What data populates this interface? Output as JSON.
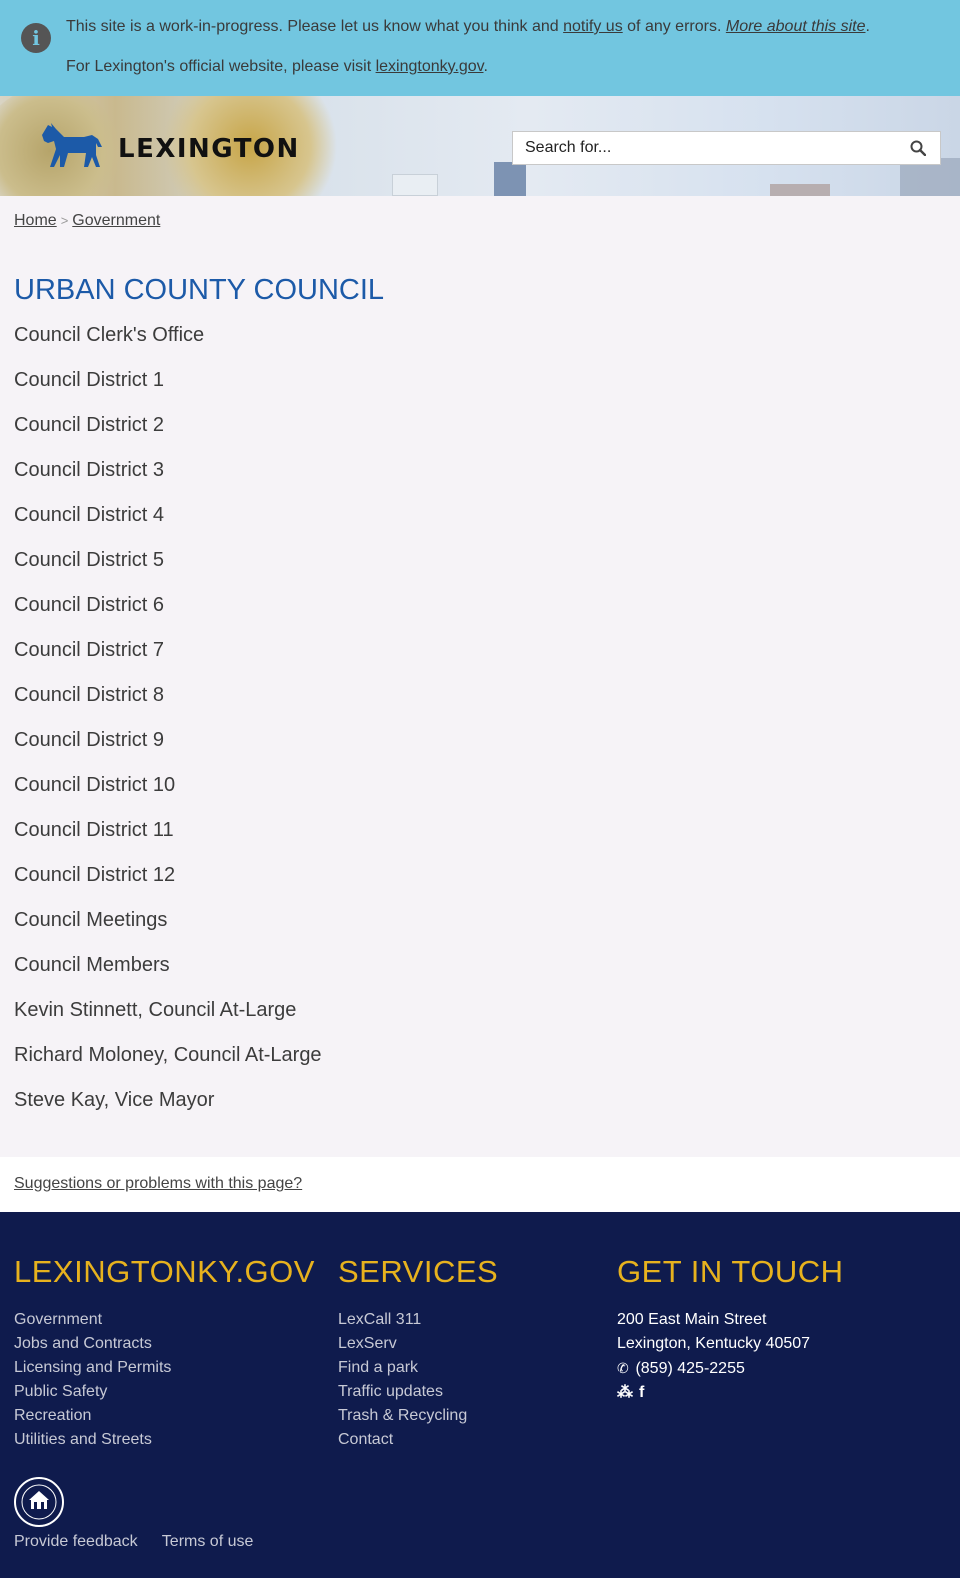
{
  "notice": {
    "line1_pre": "This site is a work-in-progress. Please let us know what you think and ",
    "notify_link": "notify us",
    "line1_mid": " of any errors. ",
    "more_link": "More about this site",
    "line1_end": ".",
    "line2_pre": "For Lexington's official website, please visit ",
    "official_link": "lexingtonky.gov",
    "line2_end": "."
  },
  "header": {
    "logo_text": "LEXINGTON",
    "search_placeholder": "Search for...",
    "horse_color": "#1c5aa8"
  },
  "breadcrumb": {
    "home": "Home",
    "sep": ">",
    "current": "Government"
  },
  "main": {
    "title": "URBAN COUNTY COUNCIL",
    "items": [
      "Council Clerk's Office",
      "Council District 1",
      "Council District 2",
      "Council District 3",
      "Council District 4",
      "Council District 5",
      "Council District 6",
      "Council District 7",
      "Council District 8",
      "Council District 9",
      "Council District 10",
      "Council District 11",
      "Council District 12",
      "Council Meetings",
      "Council Members",
      "Kevin Stinnett, Council At-Large",
      "Richard Moloney, Council At-Large",
      "Steve Kay, Vice Mayor"
    ]
  },
  "suggest": {
    "label": "Suggestions or problems with this page?"
  },
  "footer": {
    "col1": {
      "title": "LEXINGTONKY.GOV",
      "items": [
        "Government",
        "Jobs and Contracts",
        "Licensing and Permits",
        "Public Safety",
        "Recreation",
        "Utilities and Streets"
      ]
    },
    "col2": {
      "title": "SERVICES",
      "items": [
        "LexCall 311",
        "LexServ",
        "Find a park",
        "Traffic updates",
        "Trash & Recycling",
        "Contact"
      ]
    },
    "col3": {
      "title": "GET IN TOUCH",
      "address1": "200 East Main Street",
      "address2": "Lexington, Kentucky 40507",
      "phone": "(859) 425-2255",
      "twitter_icon": "twitter-icon",
      "facebook_icon": "facebook-icon"
    },
    "links": {
      "feedback": "Provide feedback",
      "terms": "Terms of use"
    },
    "colors": {
      "background": "#0f1b4d",
      "heading": "#e7b21e"
    }
  },
  "colors": {
    "notice_bg": "#72c6e0",
    "title": "#1c5aa8",
    "page_bg": "#f6f3f7"
  }
}
